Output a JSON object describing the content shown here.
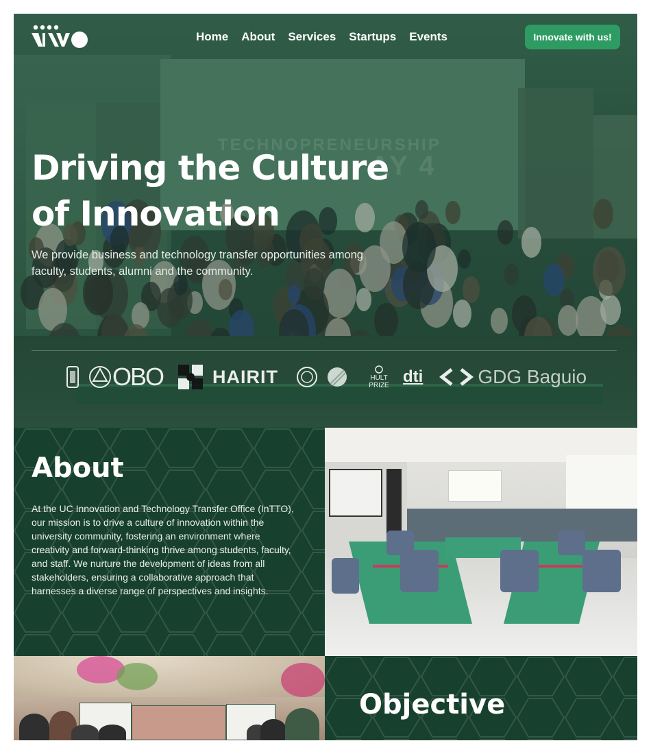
{
  "nav": {
    "logo_alt": "InTTO",
    "links": [
      "Home",
      "About",
      "Services",
      "Startups",
      "Events"
    ],
    "cta": "Innovate with us!"
  },
  "hero": {
    "headline_line1": "Driving the Culture",
    "headline_line2": "of Innovation",
    "subhead": "We provide business and technology transfer opportunities among faculty, students, alumni and the community.",
    "screen_text_1": "TECHNOPRENEURSHIP",
    "screen_text_2": "AY 4"
  },
  "partners": {
    "obo": "OBO",
    "hairit": "HAIRIT",
    "hult": "HULT PRIZE",
    "dti": "dti",
    "gdg": "GDG Baguio"
  },
  "about": {
    "title": "About",
    "body": "At the UC Innovation and Technology Transfer Office (InTTO), our mission is to drive a culture of innovation within the university community, fostering an environment where creativity and forward-thinking thrive among students, faculty, and staff. We nurture the development of ideas from all stakeholders, ensuring a collaborative approach that harnesses a diverse range of perspectives and insights."
  },
  "objective": {
    "title": "Objective"
  },
  "colors": {
    "brand_green": "#17402e",
    "cta_green": "#2e9c62",
    "text_light": "#ffffff"
  },
  "icons": [
    "intto-logo",
    "uc-seal-icon",
    "obo-logo",
    "black-white-logo",
    "hairit-logo",
    "round-seal-icon",
    "sphere-logo",
    "hult-prize-logo",
    "dti-logo",
    "gdg-logo"
  ]
}
